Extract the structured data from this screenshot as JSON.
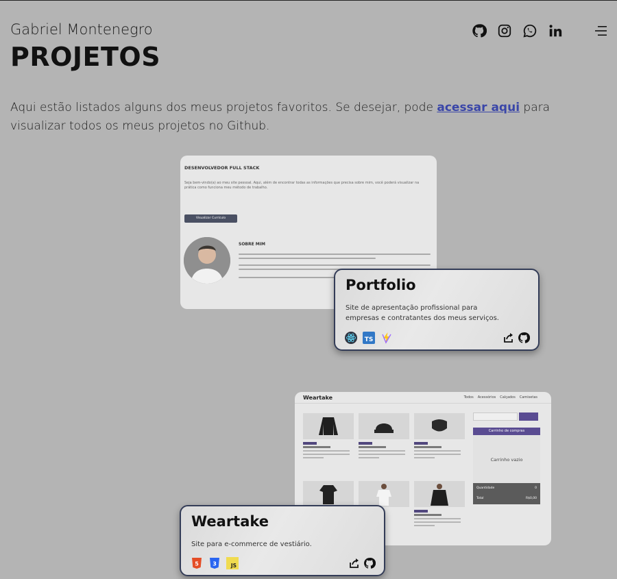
{
  "header": {
    "owner_name": "Gabriel Montenegro",
    "page_title": "PROJETOS",
    "social_icons": [
      "github-icon",
      "instagram-icon",
      "whatsapp-icon",
      "linkedin-icon"
    ],
    "menu_icon": "menu-icon"
  },
  "intro": {
    "text_before": "Aqui estão listados alguns dos meus projetos favoritos. Se desejar, pode ",
    "link_text": "acessar aqui",
    "text_after": " para visualizar todos os meus projetos no Github."
  },
  "projects": [
    {
      "title": "Portfolio",
      "description": "Site de apresentação profissional para empresas e contratantes dos meus serviços.",
      "technologies": [
        "react-icon",
        "typescript-icon",
        "vite-icon"
      ],
      "tech_labels": [
        "",
        "TS",
        ""
      ],
      "preview": {
        "heading": "DESENVOLVEDOR FULL STACK",
        "text": "Seja bem-vindo(a) ao meu site pessoal. Aqui, além de encontrar todas as informações que precisa sobre mim, você poderá visualizar na prática como funciona meu método de trabalho.",
        "button": "Visualizar Currículo",
        "about": "SOBRE MIM"
      }
    },
    {
      "title": "Weartake",
      "description": "Site para e-commerce de vestiário.",
      "technologies": [
        "html5-icon",
        "css3-icon",
        "javascript-icon"
      ],
      "tech_labels": [
        "5",
        "3",
        "JS"
      ],
      "preview": {
        "logo": "Weartake",
        "nav": [
          "Todos",
          "Acessórios",
          "Calçados",
          "Camisetas"
        ],
        "cart_header": "Carrinho de compras",
        "cart_empty": "Carrinho vazio",
        "quantity_label": "Quantidade",
        "quantity_value": "0",
        "total_label": "Total",
        "total_value": "R$0,00"
      }
    }
  ],
  "colors": {
    "background": "#b4b4b4",
    "link": "#3a46a8",
    "card_border": "#333c57",
    "accent_purple": "#5a4c92"
  }
}
